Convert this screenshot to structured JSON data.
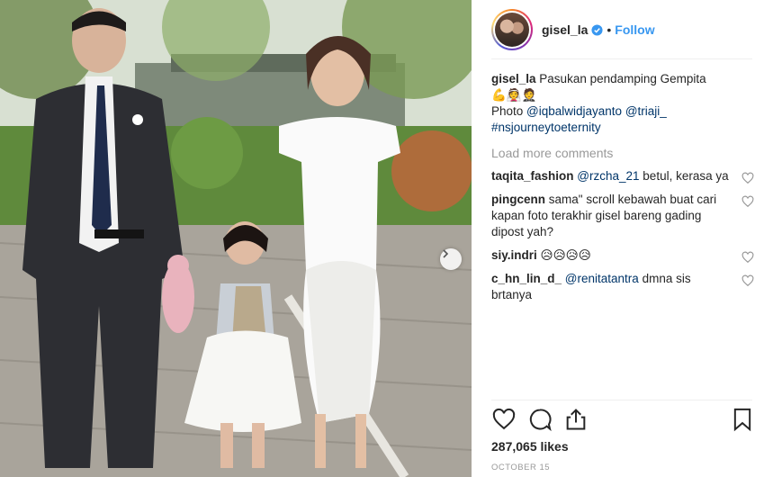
{
  "header": {
    "username": "gisel_la",
    "separator": "•",
    "follow_label": "Follow"
  },
  "caption": {
    "username": "gisel_la",
    "text": "Pasukan pendamping Gempita",
    "emoji": "💪👰🤵",
    "photo_label": "Photo",
    "mention_1": "@iqbalwidjayanto",
    "mention_2": "@triaji_",
    "hashtag": "#nsjourneytoeternity"
  },
  "load_more": "Load more comments",
  "comments": [
    {
      "username": "taqita_fashion",
      "mention": "@rzcha_21",
      "text": "betul, kerasa ya"
    },
    {
      "username": "pingcenn",
      "mention": "",
      "text": "sama\" scroll kebawah buat cari kapan foto terakhir gisel bareng gading dipost yah?"
    },
    {
      "username": "siy.indri",
      "mention": "",
      "text": "😥😥😥😥"
    },
    {
      "username": "c_hn_lin_d_",
      "mention": "@renitatantra",
      "text": "dmna sis brtanya"
    }
  ],
  "likes_text": "287,065 likes",
  "date": "OCTOBER 15",
  "colors": {
    "link": "#003569",
    "follow": "#3897f0",
    "muted": "#999999",
    "text": "#262626"
  },
  "icons": [
    "verified-badge-icon",
    "heart-icon",
    "comment-icon",
    "share-icon",
    "bookmark-icon",
    "next-arrow-icon"
  ]
}
